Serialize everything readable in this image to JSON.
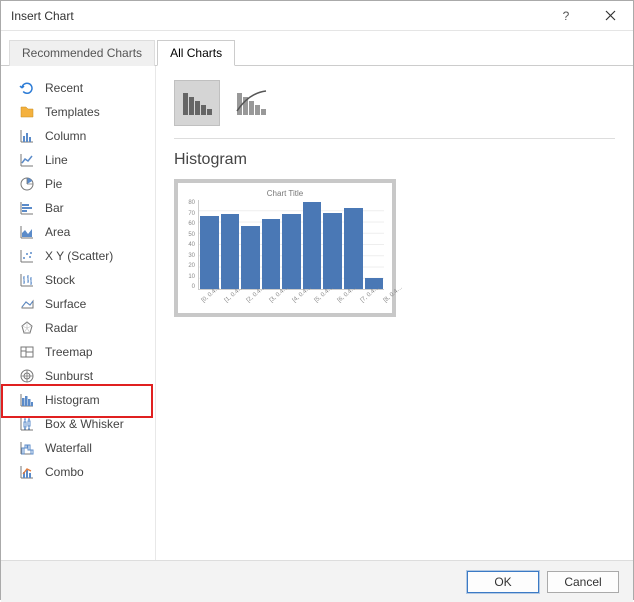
{
  "window": {
    "title": "Insert Chart"
  },
  "tabs": {
    "recommended": "Recommended Charts",
    "all": "All Charts"
  },
  "sidebar": {
    "items": [
      {
        "label": "Recent"
      },
      {
        "label": "Templates"
      },
      {
        "label": "Column"
      },
      {
        "label": "Line"
      },
      {
        "label": "Pie"
      },
      {
        "label": "Bar"
      },
      {
        "label": "Area"
      },
      {
        "label": "X Y (Scatter)"
      },
      {
        "label": "Stock"
      },
      {
        "label": "Surface"
      },
      {
        "label": "Radar"
      },
      {
        "label": "Treemap"
      },
      {
        "label": "Sunburst"
      },
      {
        "label": "Histogram"
      },
      {
        "label": "Box & Whisker"
      },
      {
        "label": "Waterfall"
      },
      {
        "label": "Combo"
      }
    ]
  },
  "main": {
    "section_title": "Histogram"
  },
  "chart_data": {
    "type": "bar",
    "title": "Chart Title",
    "categories": [
      "[0, 0.4…",
      "[1, 0.4…",
      "[2, 0.4…",
      "[3, 0.4…",
      "[4, 0.4…",
      "[5, 0.4…",
      "[6, 0.4…",
      "[7, 0.4…",
      "[8, 0.4…"
    ],
    "values": [
      66,
      67,
      57,
      63,
      67,
      78,
      68,
      73,
      10
    ],
    "y_ticks": [
      0,
      10,
      20,
      30,
      40,
      50,
      60,
      70,
      80
    ],
    "ylim": [
      0,
      80
    ],
    "xlabel": "",
    "ylabel": ""
  },
  "footer": {
    "ok": "OK",
    "cancel": "Cancel"
  }
}
